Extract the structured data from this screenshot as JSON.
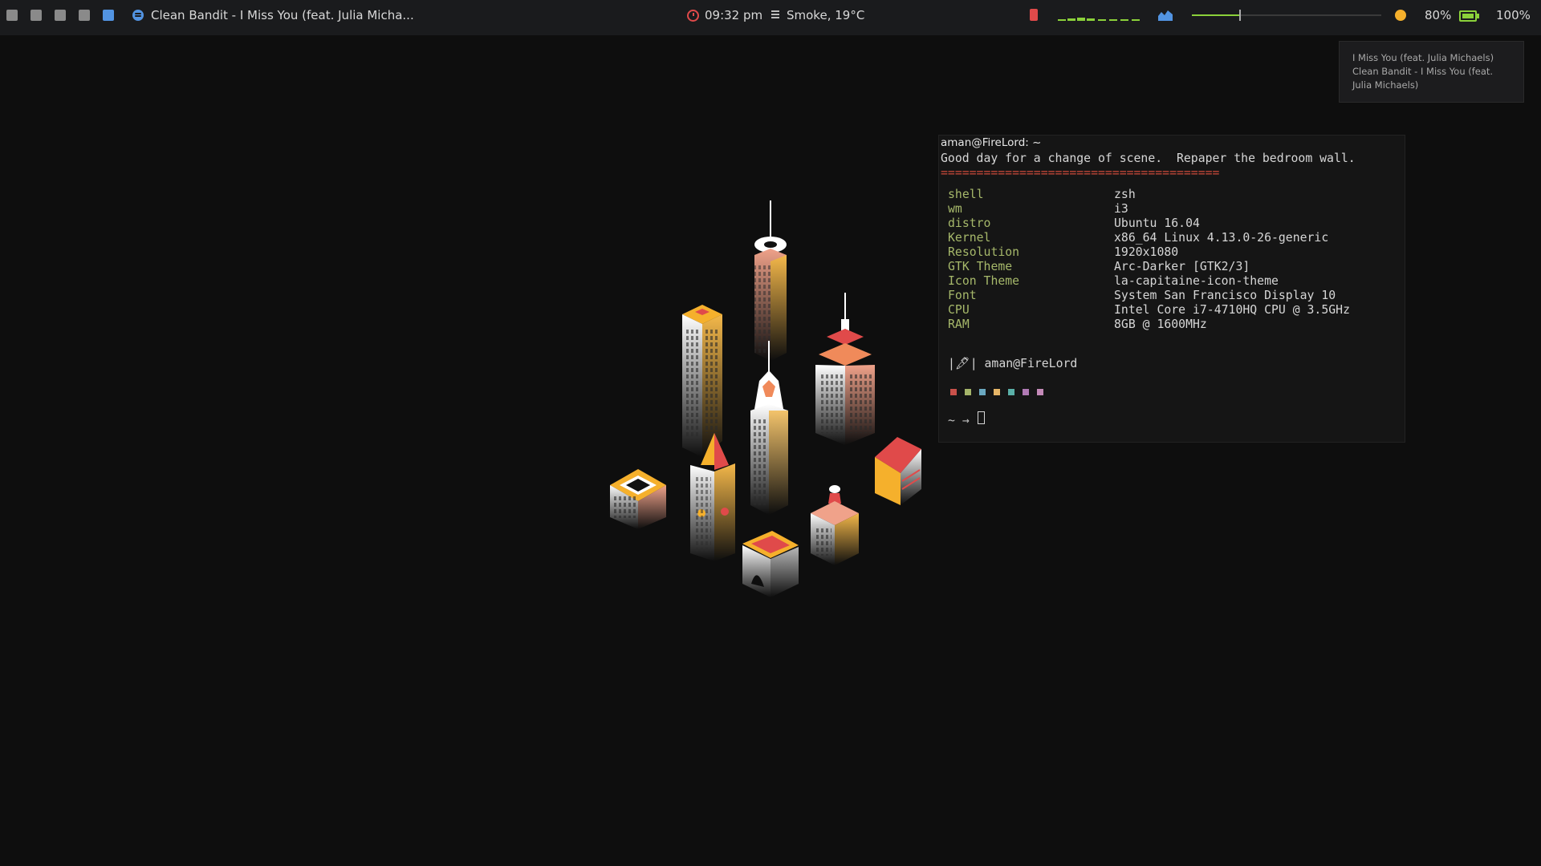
{
  "topbar": {
    "workspaces": [
      "workspace-1",
      "workspace-2",
      "workspace-3",
      "workspace-4",
      "workspace-5"
    ],
    "active_workspace": 5,
    "now_playing": "Clean Bandit - I Miss You (feat. Julia Micha...",
    "clock": "09:32 pm",
    "weather": "Smoke, 19°C",
    "volume_level": 0.25,
    "brightness": "80%",
    "battery": "100%",
    "colors": {
      "accent": "#5294e2",
      "alert": "#e04a4a",
      "good": "#8bd13a",
      "warn": "#f5b02c"
    }
  },
  "notification": {
    "line1": "I Miss You (feat. Julia Michaels)",
    "line2": "Clean Bandit - I Miss You (feat.",
    "line3": "Julia Michaels)"
  },
  "terminal": {
    "title": "aman@FireLord: ~",
    "motd": "Good day for a change of scene.  Repaper the bedroom wall.",
    "rule": "=======================================",
    "info": [
      {
        "key": "shell",
        "value": "zsh"
      },
      {
        "key": "wm",
        "value": "i3"
      },
      {
        "key": "distro",
        "value": "Ubuntu 16.04"
      },
      {
        "key": "Kernel",
        "value": "x86_64 Linux 4.13.0-26-generic"
      },
      {
        "key": "Resolution",
        "value": "1920x1080"
      },
      {
        "key": "GTK Theme",
        "value": "Arc-Darker [GTK2/3]"
      },
      {
        "key": "Icon Theme",
        "value": "la-capitaine-icon-theme"
      },
      {
        "key": "Font",
        "value": "System San Francisco Display 10"
      },
      {
        "key": "CPU",
        "value": "Intel Core i7-4710HQ CPU @ 3.5GHz"
      },
      {
        "key": "RAM",
        "value": "8GB @ 1600MHz"
      }
    ],
    "user_line": "|🖋| aman@FireLord",
    "palette": [
      "#c9514a",
      "#a5b56a",
      "#6aa8c0",
      "#e5b567",
      "#5ab0a8",
      "#b07ab4",
      "#c48ab8"
    ],
    "prompt": "~ →"
  }
}
